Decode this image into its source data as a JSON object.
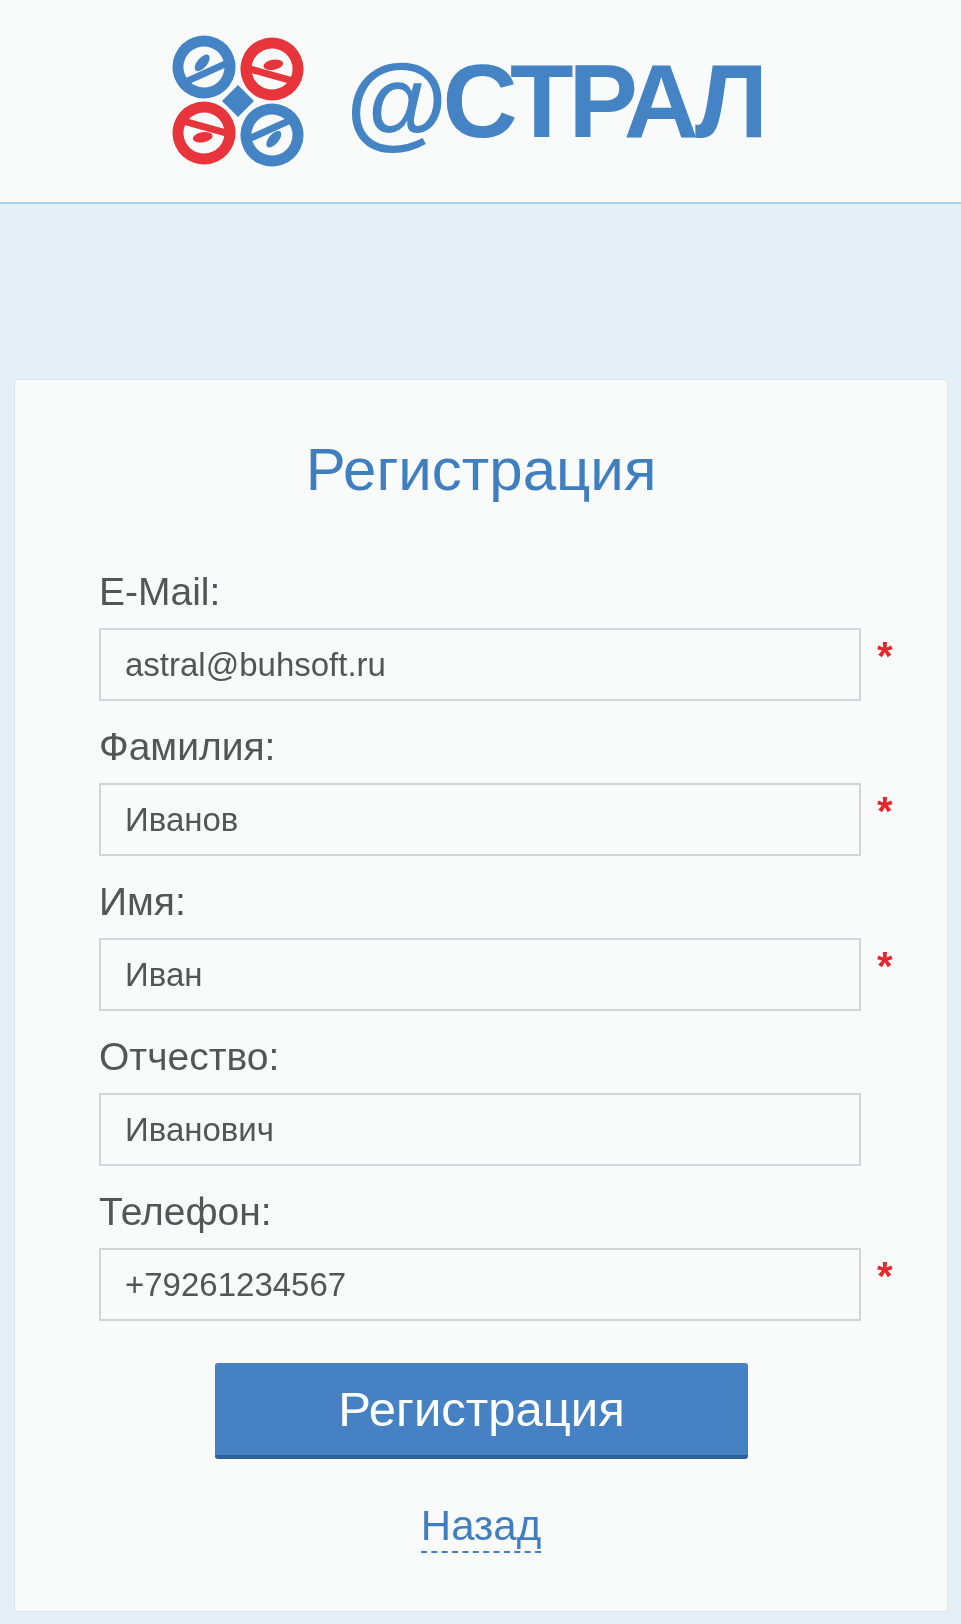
{
  "header": {
    "logo_text": "@СТРАЛ"
  },
  "form": {
    "title": "Регистрация",
    "fields": [
      {
        "label": "E-Mail:",
        "value": "astral@buhsoft.ru",
        "mark": "*"
      },
      {
        "label": "Фамилия:",
        "value": "Иванов",
        "mark": "*"
      },
      {
        "label": "Имя:",
        "value": "Иван",
        "mark": "*"
      },
      {
        "label": "Отчество:",
        "value": "Иванович"
      },
      {
        "label": "Телефон:",
        "value": "+79261234567",
        "mark": "*"
      }
    ],
    "submit": "Регистрация",
    "back_link": "Назад"
  }
}
